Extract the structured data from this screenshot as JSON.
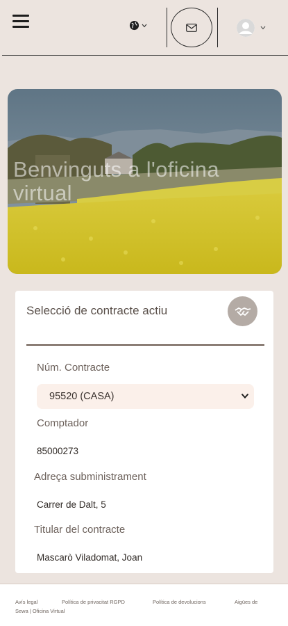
{
  "header": {
    "menu_icon": "hamburger-menu-icon",
    "language_icon": "globe-icon",
    "mail_icon": "envelope-icon",
    "profile_icon": "user-avatar-icon"
  },
  "hero": {
    "title": "Benvinguts a l'oficina virtual"
  },
  "card": {
    "title": "Selecció de contracte actiu",
    "action_icon": "handshake-icon",
    "contract_label": "Núm. Contracte",
    "contract_selected": "95520 (CASA)",
    "meter_label": "Comptador",
    "meter_value": "85000273",
    "address_label": "Adreça subministrament",
    "address_value": "Carrer de Dalt, 5",
    "holder_label": "Titular del contracte",
    "holder_value": "Mascarò Viladomat, Joan"
  },
  "footer": {
    "legal": "Avís legal",
    "privacy": "Política de privacitat RGPD",
    "returns": "Política de devolucions",
    "brand_line1": "Aigües de",
    "brand_line2": "Sewa | Oficina Virtual"
  },
  "colors": {
    "background": "#ece4df",
    "card": "#ffffff",
    "accent": "#6b5a50",
    "select_bg": "#fbf0ea",
    "icon_button": "#b4aba5"
  }
}
